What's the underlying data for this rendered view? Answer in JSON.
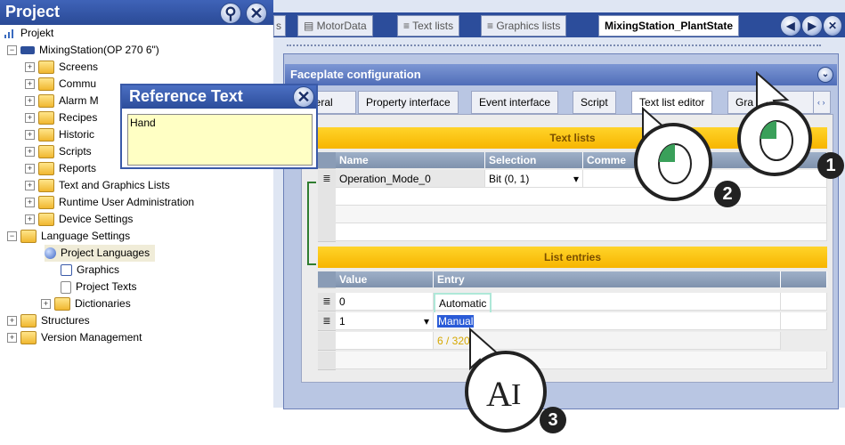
{
  "project_pane": {
    "title": "Project",
    "tree": [
      {
        "label": "Projekt",
        "level": 0
      },
      {
        "label": "MixingStation(OP 270 6\")",
        "level": 1
      },
      {
        "label": "Screens",
        "level": 2
      },
      {
        "label": "Commu",
        "level": 2
      },
      {
        "label": "Alarm M",
        "level": 2
      },
      {
        "label": "Recipes",
        "level": 2
      },
      {
        "label": "Historic",
        "level": 2
      },
      {
        "label": "Scripts",
        "level": 2
      },
      {
        "label": "Reports",
        "level": 2
      },
      {
        "label": "Text and Graphics Lists",
        "level": 2
      },
      {
        "label": "Runtime User Administration",
        "level": 2
      },
      {
        "label": "Device Settings",
        "level": 2
      },
      {
        "label": "Language Settings",
        "level": 1
      },
      {
        "label": "Project Languages",
        "level": 2
      },
      {
        "label": "Graphics",
        "level": 2
      },
      {
        "label": "Project Texts",
        "level": 2
      },
      {
        "label": "Dictionaries",
        "level": 2
      },
      {
        "label": "Structures",
        "level": 1
      },
      {
        "label": "Version Management",
        "level": 1
      }
    ]
  },
  "reference_popup": {
    "title": "Reference Text",
    "text": "Hand"
  },
  "doc_tabs": [
    "s",
    "MotorData",
    "Text lists",
    "Graphics lists",
    "MixingStation_PlantState"
  ],
  "faceplate": {
    "title": "Faceplate configuration",
    "tabs": [
      "neral",
      "Property interface",
      "Event interface",
      "Script",
      "Text list editor",
      "Gra"
    ],
    "text_lists_title": "Text lists",
    "text_lists_columns": [
      "Name",
      "Selection",
      "Comme"
    ],
    "text_lists_rows": [
      {
        "name": "Operation_Mode_0",
        "selection": "Bit (0, 1)"
      }
    ],
    "list_entries_title": "List entries",
    "list_entries_columns": [
      "Value",
      "Entry"
    ],
    "list_entries_rows": [
      {
        "value": "0",
        "entry": "Automatic"
      },
      {
        "value": "1",
        "entry": "Manual"
      }
    ],
    "char_count": "6 / 320"
  },
  "annotations": [
    "1",
    "2",
    "3"
  ],
  "icons": {
    "pin": "pin-icon",
    "close": "close-icon",
    "nav_left": "arrow-left-icon",
    "nav_right": "arrow-right-icon",
    "collapse": "chevron-down-icon"
  }
}
